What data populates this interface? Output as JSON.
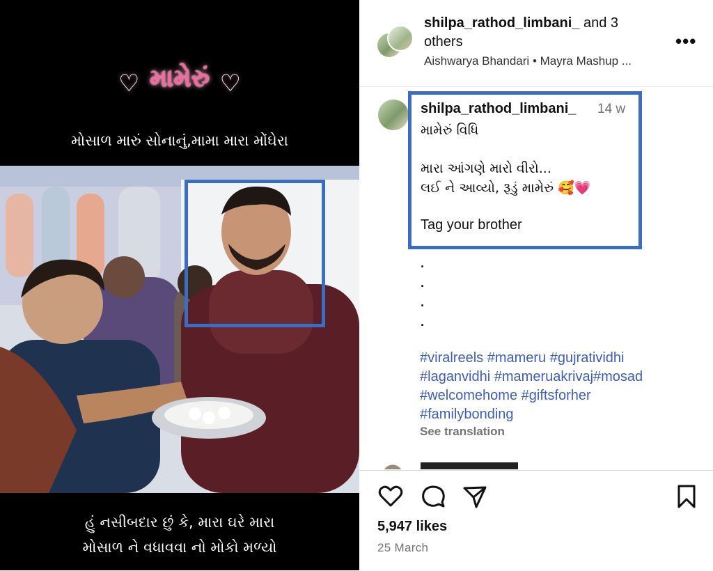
{
  "media": {
    "title": "મામેરું",
    "caption_top": "મોસાળ મારું સોનાનું,મામા મારા મોંઘેરા",
    "caption_bottom_line1": "હું નસીબદાર છું કે, મારા ઘરે મારા",
    "caption_bottom_line2": "મોસાળ ને વધાવવા નો મોકો મળ્યો"
  },
  "header": {
    "username": "shilpa_rathod_limbani_",
    "and_others": "and 3 others",
    "music_artist": "Aishwarya Bhandari",
    "separator": "•",
    "music_title": "Mayra Mashup ..."
  },
  "comment": {
    "username": "shilpa_rathod_limbani_",
    "time": "14 w",
    "line1": "મામેરું વિધિ",
    "line2": "મારા આંગણે મારો વીરો...",
    "line3": "લઈ ને આવ્યો, રૂડું મામેરું 🥰💗",
    "line4": "Tag your brother",
    "dots": [
      ".",
      ".",
      ".",
      "."
    ],
    "hashtags": [
      "#viralreels #mameru #gujrativi​dhi",
      "#laganvidhi #mameruakrivaj#mosad",
      "#welcomehome #giftsforher",
      "#familybonding"
    ],
    "see_translation": "See translation"
  },
  "footer": {
    "likes": "5,947 likes",
    "date": "25 March"
  },
  "colors": {
    "hashtag": "#3c5eb8",
    "highlight_box": "#3b6ec0",
    "muted": "#737373"
  },
  "icons": [
    "heart-icon",
    "comment-icon",
    "share-icon",
    "bookmark-icon",
    "more-icon"
  ]
}
